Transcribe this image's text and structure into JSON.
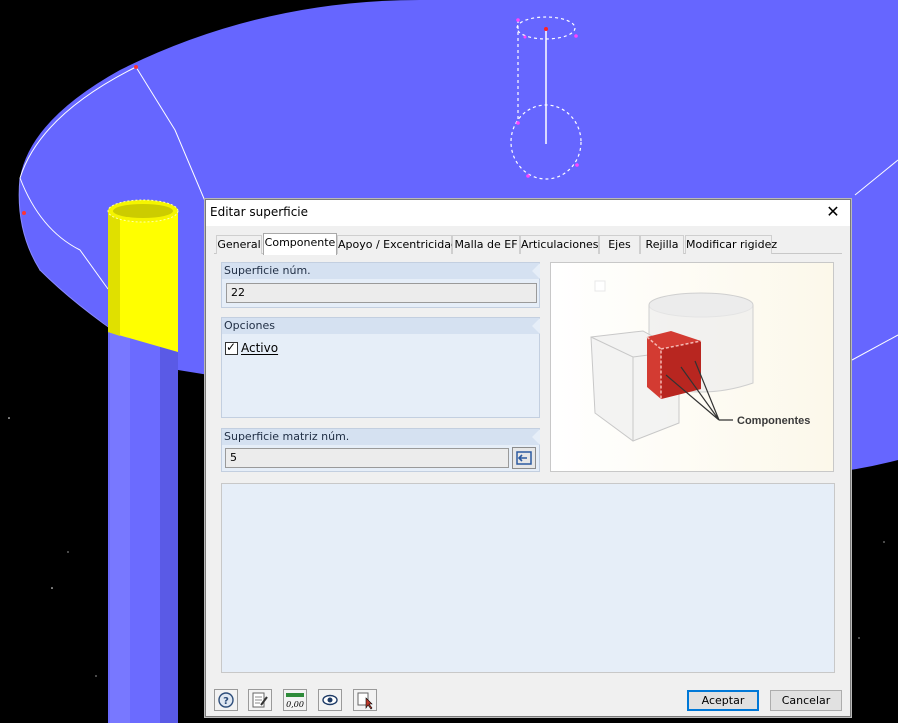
{
  "dialog": {
    "title": "Editar superficie",
    "close_symbol": "✕"
  },
  "tabs": [
    {
      "label": "General",
      "active": false
    },
    {
      "label": "Componente",
      "active": true
    },
    {
      "label": "Apoyo / Excentricidad",
      "active": false
    },
    {
      "label": "Malla de EF",
      "active": false
    },
    {
      "label": "Articulaciones",
      "active": false
    },
    {
      "label": "Ejes",
      "active": false
    },
    {
      "label": "Rejilla",
      "active": false
    },
    {
      "label": "Modificar rigidez",
      "active": false
    }
  ],
  "surface_number": {
    "header": "Superficie núm.",
    "value": "22"
  },
  "options": {
    "header": "Opciones",
    "active_label": "Activo",
    "active_checked": true,
    "check_symbol": "✓"
  },
  "parent_surface": {
    "header": "Superficie matriz núm.",
    "value": "5",
    "select_icon": "select-in-model-icon"
  },
  "preview": {
    "component_label": "Componentes"
  },
  "toolbar": {
    "icons": [
      "help-icon",
      "edit-icon",
      "numeric-value-icon",
      "view-icon",
      "select-icon"
    ],
    "numeric_text": "0,00"
  },
  "buttons": {
    "ok": "Aceptar",
    "cancel": "Cancelar"
  },
  "colors": {
    "model_surface": "#6666ff",
    "column_highlight": "#ffff00",
    "background": "#000000",
    "accent": "#0078d7"
  }
}
